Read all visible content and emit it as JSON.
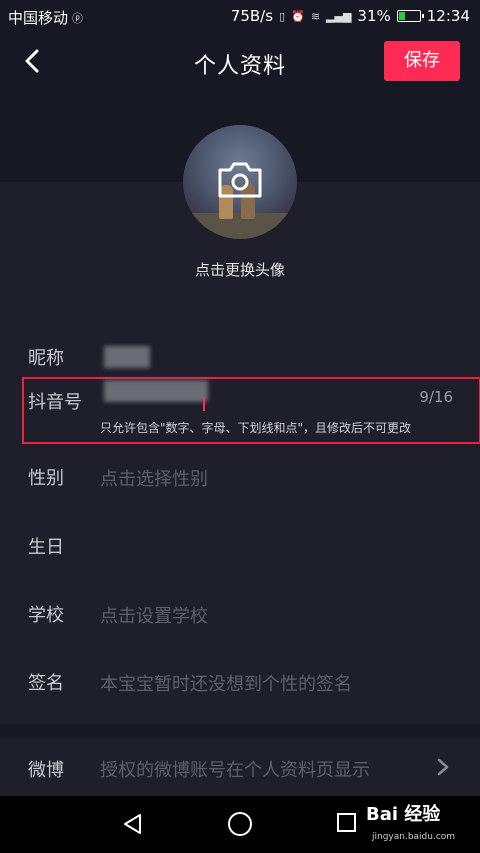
{
  "status_bar": {
    "carrier": "中国移动",
    "speed": "75B/s",
    "battery_percent": "31%",
    "time": "12:34"
  },
  "header": {
    "title": "个人资料",
    "save_label": "保存"
  },
  "avatar": {
    "hint": "点击更换头像"
  },
  "fields": {
    "nickname": {
      "label": "昵称"
    },
    "douyin_id": {
      "label": "抖音号",
      "counter": "9/16",
      "hint": "只允许包含\"数字、字母、下划线和点\"，且修改后不可更改"
    },
    "gender": {
      "label": "性别",
      "placeholder": "点击选择性别"
    },
    "birthday": {
      "label": "生日"
    },
    "school": {
      "label": "学校",
      "placeholder": "点击设置学校"
    },
    "signature": {
      "label": "签名",
      "placeholder": "本宝宝暂时还没想到个性的签名"
    },
    "weibo": {
      "label": "微博",
      "placeholder": "授权的微博账号在个人资料页显示"
    }
  },
  "watermark": {
    "brand": "Bai 经验",
    "url": "jingyan.baidu.com"
  },
  "colors": {
    "accent": "#fe2c55",
    "background": "#161823",
    "highlight_box": "#e8243f"
  }
}
